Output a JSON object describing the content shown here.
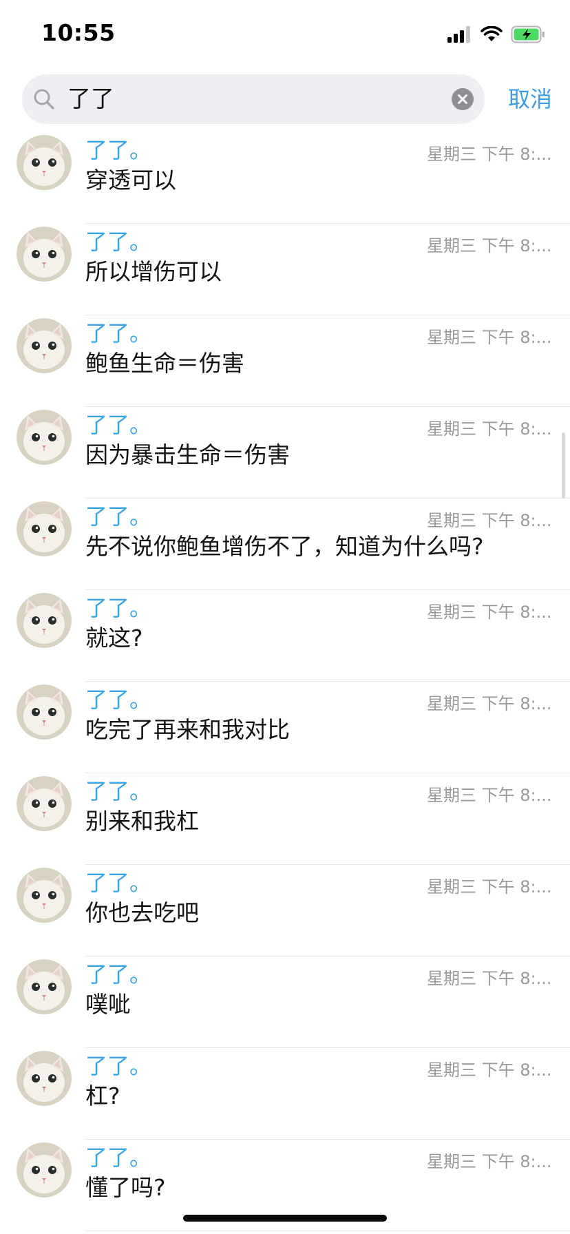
{
  "status_bar": {
    "time": "10:55",
    "signal_icon": "cellular-signal-icon",
    "wifi_icon": "wifi-icon",
    "battery_icon": "battery-charging-icon",
    "battery_color": "#4cd964"
  },
  "search": {
    "query": "了了",
    "search_icon": "search-icon",
    "clear_icon": "clear-icon",
    "cancel_label": "取消"
  },
  "colors": {
    "accent": "#3a9de6",
    "sender": "#3aa5e6",
    "timestamp": "#9a9a9e",
    "search_background": "#eeeff3"
  },
  "results": [
    {
      "sender": "了了。",
      "time": "星期三 下午 8:...",
      "message": "穿透可以",
      "avatar": "cat-avatar"
    },
    {
      "sender": "了了。",
      "time": "星期三 下午 8:...",
      "message": "所以增伤可以",
      "avatar": "cat-avatar"
    },
    {
      "sender": "了了。",
      "time": "星期三 下午 8:...",
      "message": "鲍鱼生命＝伤害",
      "avatar": "cat-avatar"
    },
    {
      "sender": "了了。",
      "time": "星期三 下午 8:...",
      "message": "因为暴击生命＝伤害",
      "avatar": "cat-avatar"
    },
    {
      "sender": "了了。",
      "time": "星期三 下午 8:...",
      "message": "先不说你鲍鱼增伤不了，知道为什么吗?",
      "avatar": "cat-avatar"
    },
    {
      "sender": "了了。",
      "time": "星期三 下午 8:...",
      "message": "就这?",
      "avatar": "cat-avatar"
    },
    {
      "sender": "了了。",
      "time": "星期三 下午 8:...",
      "message": "吃完了再来和我对比",
      "avatar": "cat-avatar"
    },
    {
      "sender": "了了。",
      "time": "星期三 下午 8:...",
      "message": "别来和我杠",
      "avatar": "cat-avatar"
    },
    {
      "sender": "了了。",
      "time": "星期三 下午 8:...",
      "message": "你也去吃吧",
      "avatar": "cat-avatar"
    },
    {
      "sender": "了了。",
      "time": "星期三 下午 8:...",
      "message": "噗呲",
      "avatar": "cat-avatar"
    },
    {
      "sender": "了了。",
      "time": "星期三 下午 8:...",
      "message": "杠?",
      "avatar": "cat-avatar"
    },
    {
      "sender": "了了。",
      "time": "星期三 下午 8:...",
      "message": "懂了吗?",
      "avatar": "cat-avatar"
    }
  ]
}
